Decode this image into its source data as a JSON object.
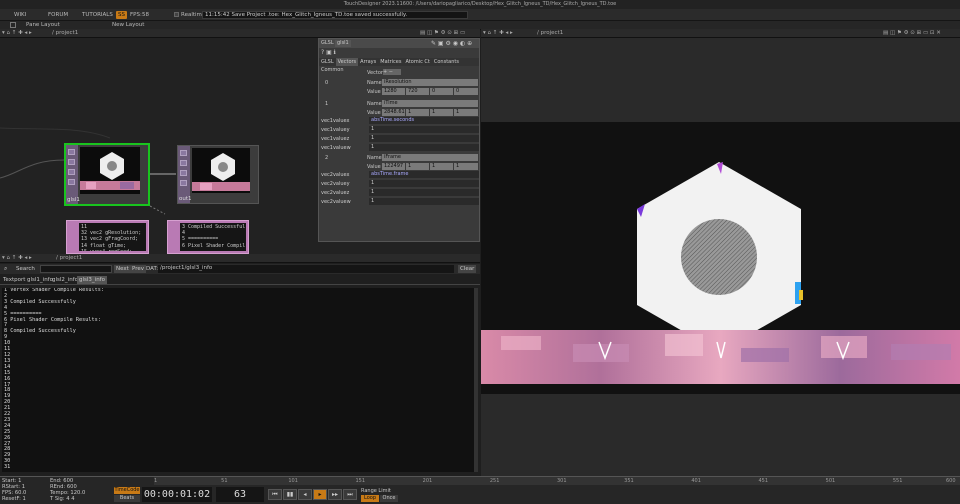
{
  "window": {
    "title": "TouchDesigner 2023.11600: /Users/dariopagliarico/Desktop/Hex_Glitch_Igneus_TD/Hex_Glitch_Igneus_TD.toe"
  },
  "menubar": {
    "items": [
      "WIKI",
      "FORUM",
      "TUTORIALS"
    ],
    "badge": "SS",
    "fps_label": "FPS:",
    "fps_value": "58",
    "realtime_label": "Realtime",
    "message": "11:15:42 Save Project .toe: Hex_Glitch_Igneus_TD.toe saved successfully."
  },
  "toolbar": {
    "pane_layout": "Pane Layout",
    "new_layout": "New Layout"
  },
  "left_pane": {
    "path": "/ project1"
  },
  "right_pane": {
    "path": "/ project1"
  },
  "text_pane": {
    "path": "/ project1"
  },
  "nodes": {
    "glsl1": {
      "name": "glsl1"
    },
    "out1": {
      "name": "out1"
    },
    "info1_text": "11\n32 vec2 gResolution;\n13 vec2 gFragCoord;\n14 float gTime;\n15 uvec4 rngSeed;",
    "info2_text": "3 Compiled Successful\n4\n5 ==========\n6 Pixel Shader Compil"
  },
  "params": {
    "header_type": "GLSL",
    "header_name": "glsl1",
    "tabs": [
      "GLSL",
      "Vectors",
      "Arrays",
      "Matrices",
      "Atomic Ct",
      "Constants",
      "Common"
    ],
    "vector_label": "Vector",
    "vec0": {
      "index": "0",
      "name_label": "Name",
      "name": "iResolution",
      "value_label": "Value",
      "values": [
        "1280",
        "720",
        "0",
        "0"
      ]
    },
    "vec1": {
      "index": "1",
      "name_label": "Name",
      "name": "iTime",
      "value_label": "Value",
      "values": [
        "2848.61",
        "1",
        "1",
        "1"
      ],
      "rows": [
        "vec1valuex",
        "vec1valuey",
        "vec1valuez",
        "vec1valuew"
      ],
      "expr": "absTime.seconds"
    },
    "vec2": {
      "index": "2",
      "name_label": "Name",
      "name": "iFrame",
      "value_label": "Value",
      "values": [
        "122497",
        "1",
        "1",
        "1"
      ],
      "rows": [
        "vec2valuex",
        "vec2valuey",
        "vec2valuez",
        "vec2valuew"
      ],
      "expr": "absTime.frame"
    },
    "zeros": [
      "0",
      "0",
      "0",
      "0",
      "0",
      "0"
    ]
  },
  "textport": {
    "search_label": "Search",
    "next": "Next",
    "prev": "Prev",
    "dat_label": "DAT:",
    "dat_value": "/project1/glsl3_info",
    "clear": "Clear",
    "tabs": [
      "Textport",
      "glsl1_info",
      "glsl2_info",
      "glsl3_info"
    ],
    "lines": "1 Vertex Shader Compile Results:\n2\n3 Compiled Successfully\n4\n5 ==========\n6 Pixel Shader Compile Results:\n7\n8 Compiled Successfully\n9\n10\n11\n12\n13\n14\n15\n16\n17\n18\n19\n20\n21\n22\n23\n24\n25\n26\n27\n28\n29\n30\n31"
  },
  "timeline": {
    "stats": [
      {
        "k": "Start:",
        "v": "1"
      },
      {
        "k": "RStart:",
        "v": "1"
      },
      {
        "k": "FPS:",
        "v": "60.0"
      },
      {
        "k": "ResetF:",
        "v": "1"
      }
    ],
    "stats2": [
      {
        "k": "End:",
        "v": "600"
      },
      {
        "k": "REnd:",
        "v": "600"
      },
      {
        "k": "Tempo:",
        "v": "120.0"
      },
      {
        "k": "T Sig:",
        "v": "4  4"
      }
    ],
    "timecode": "00:00:01:02",
    "frame": "63",
    "timecode_btn": "TimeCode",
    "beats_btn": "Beats",
    "range_label": "Range Limit",
    "loop_btn": "Loop",
    "once_btn": "Once",
    "ruler_ticks": [
      "1",
      "51",
      "101",
      "151",
      "201",
      "251",
      "301",
      "351",
      "401",
      "451",
      "501",
      "551",
      "600"
    ]
  },
  "colors": {
    "accent": "#c87a16",
    "selected": "#19c41e",
    "node_purple": "#6a5a78",
    "dat_pink": "#b97ab4"
  }
}
